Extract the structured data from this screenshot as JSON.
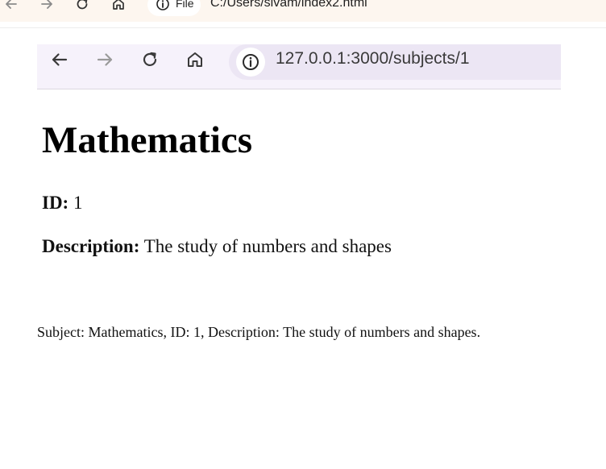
{
  "outer_browser": {
    "site_chip_label": "File",
    "address": "C:/Users/sivam/index2.html",
    "icons": [
      "back-arrow-icon",
      "forward-arrow-icon",
      "reload-icon",
      "home-icon",
      "info-icon"
    ]
  },
  "inner_browser": {
    "address": "127.0.0.1:3000/subjects/1",
    "icons": [
      "back-arrow-icon",
      "forward-arrow-icon",
      "reload-icon",
      "home-icon",
      "info-icon"
    ]
  },
  "subject": {
    "title": "Mathematics",
    "id_label": "ID:",
    "id_value": "1",
    "description_label": "Description:",
    "description_value": "The study of numbers and shapes"
  },
  "summary": {
    "text": "Subject: Mathematics, ID: 1, Description: The study of numbers and shapes."
  }
}
